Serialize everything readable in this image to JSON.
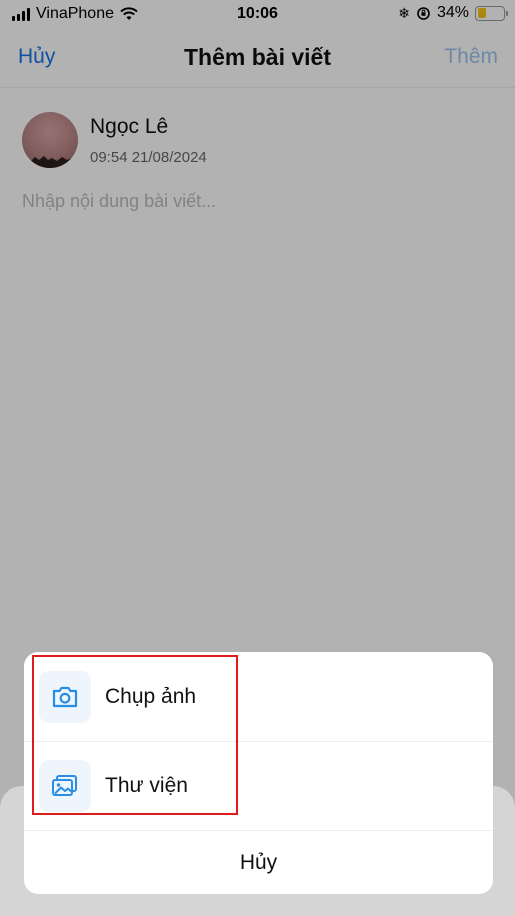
{
  "status_bar": {
    "carrier": "VinaPhone",
    "time": "10:06",
    "battery_percent": "34%",
    "battery_level": 0.34,
    "icons": [
      "signal-bars-icon",
      "wifi-icon",
      "snowflake-icon",
      "orientation-lock-icon",
      "battery-icon"
    ]
  },
  "nav": {
    "cancel_label": "Hủy",
    "title": "Thêm bài viết",
    "add_label": "Thêm"
  },
  "post": {
    "user_name": "Ngọc Lê",
    "timestamp": "09:54 21/08/2024",
    "content_placeholder": "Nhập nội dung bài viết..."
  },
  "action_sheet": {
    "items": [
      {
        "label": "Chụp ảnh",
        "icon": "camera-icon"
      },
      {
        "label": "Thư viện",
        "icon": "gallery-icon"
      }
    ],
    "cancel_label": "Hủy"
  },
  "colors": {
    "accent": "#1a73e8",
    "accent_disabled": "#9cc3f0",
    "icon_blue": "#2b8ee6",
    "highlight": "#e01b1b",
    "battery": "#f5c518"
  }
}
